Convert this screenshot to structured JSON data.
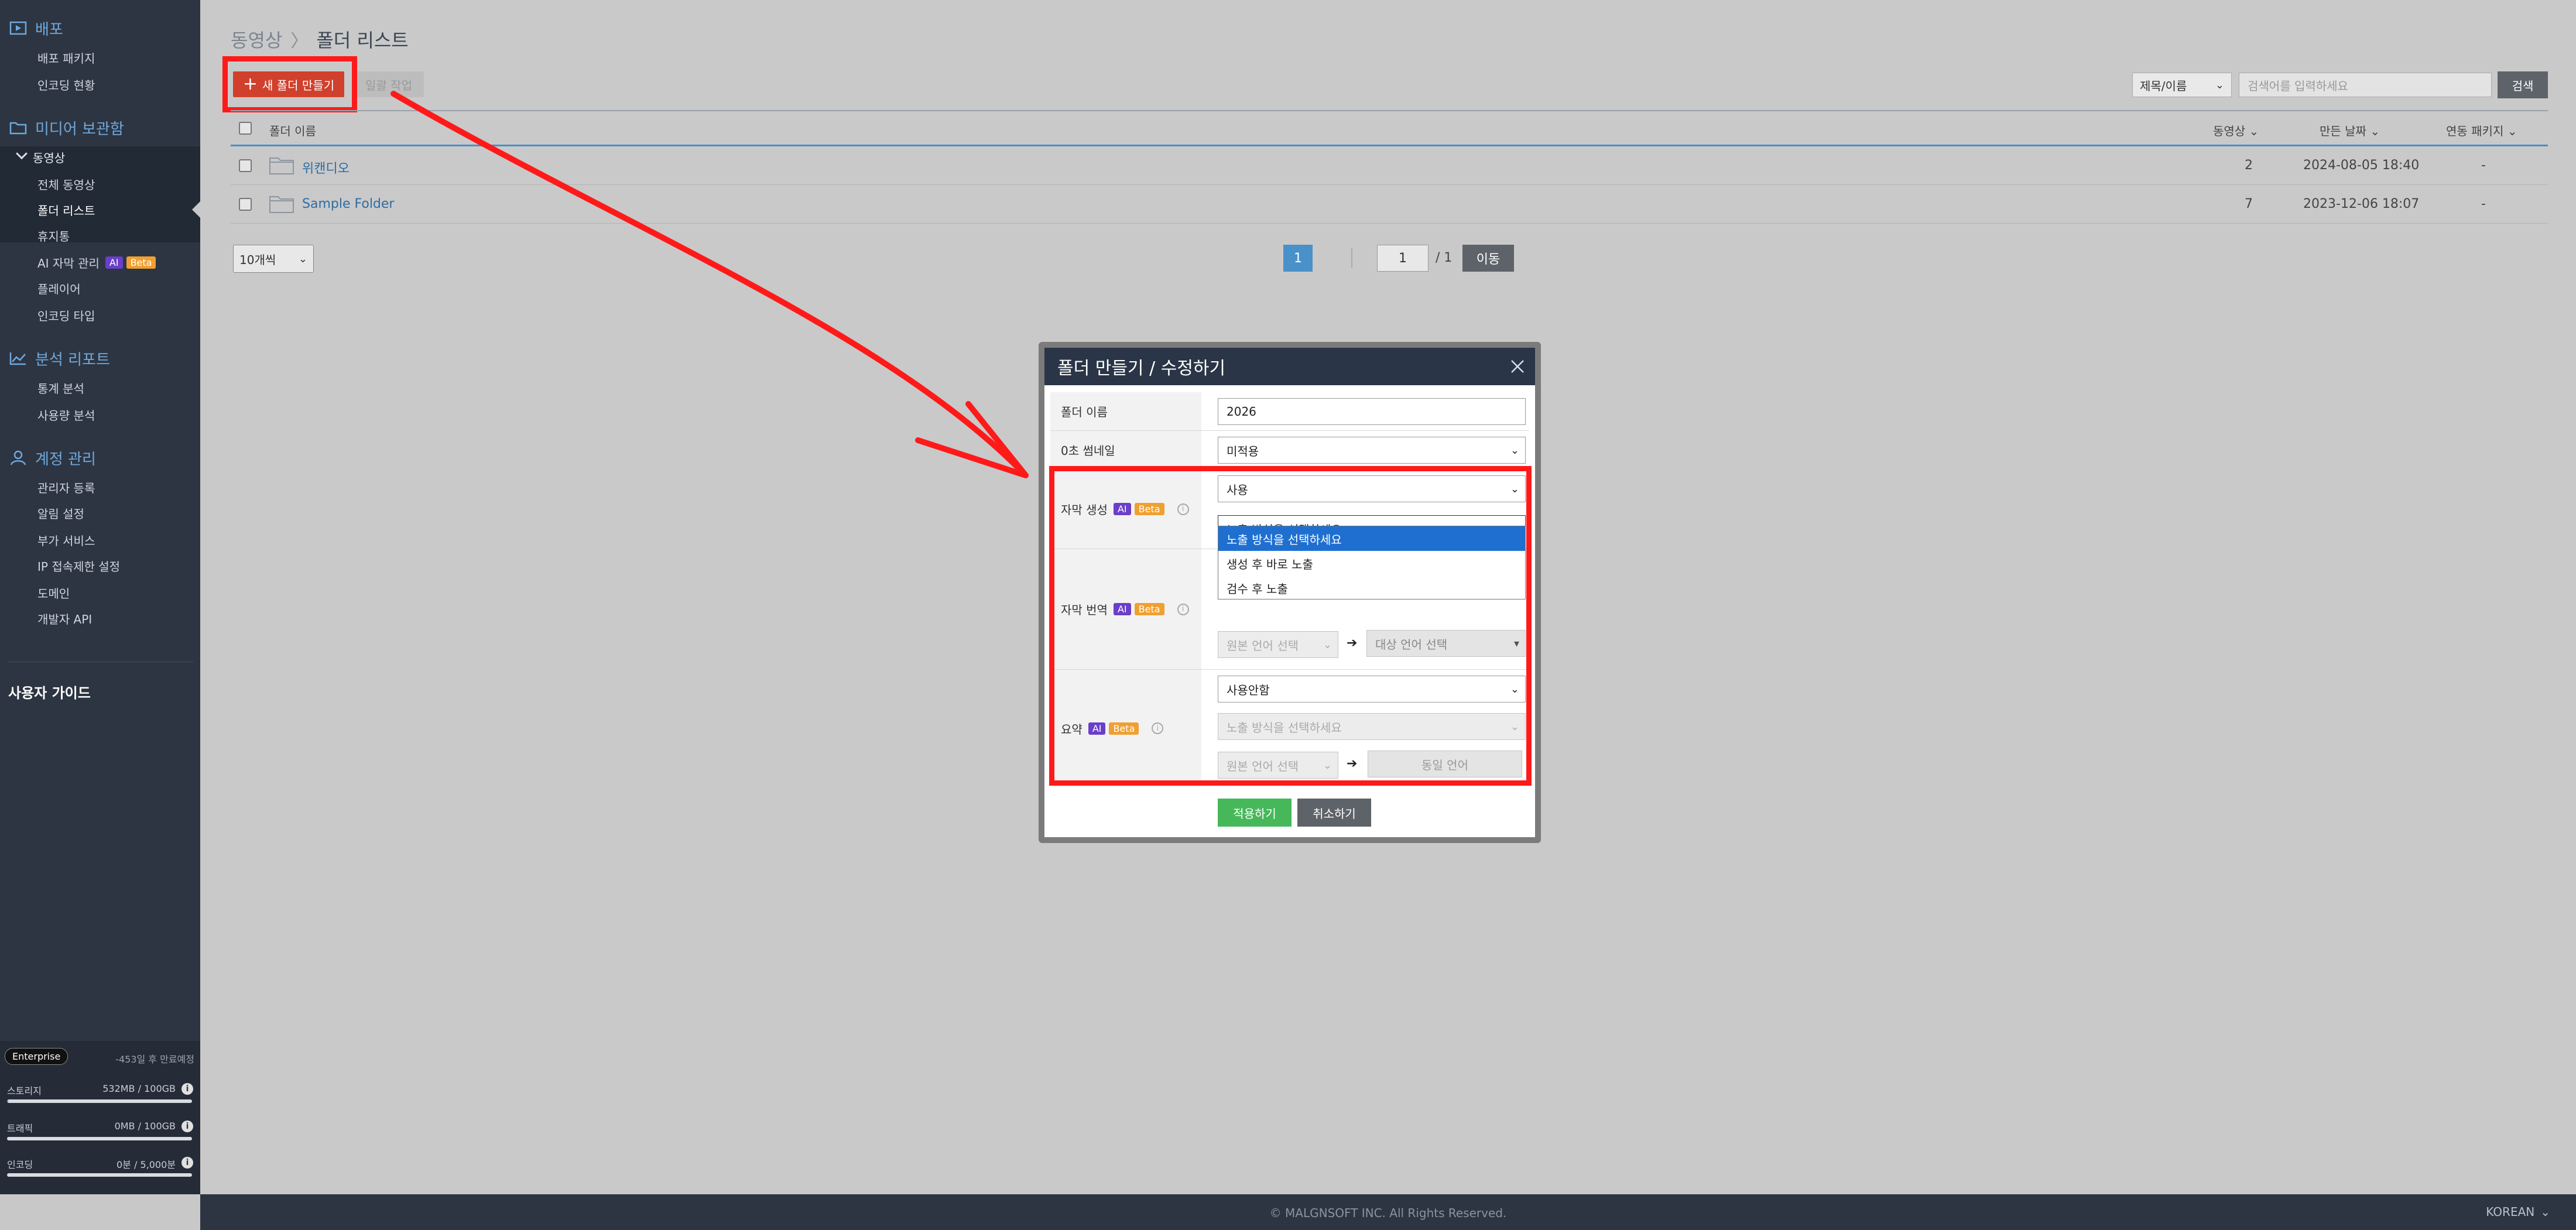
{
  "sidebar": {
    "sections": [
      {
        "title": "배포",
        "icon": "deploy-icon",
        "items": [
          "배포 패키지",
          "인코딩 현황"
        ]
      },
      {
        "title": "미디어 보관함",
        "icon": "folder-icon",
        "group": "동영상",
        "group_items": [
          "전체 동영상",
          "폴더 리스트",
          "휴지통"
        ],
        "items": [
          "AI 자막 관리",
          "플레이어",
          "인코딩 타입"
        ]
      },
      {
        "title": "분석 리포트",
        "icon": "chart-icon",
        "items": [
          "통계 분석",
          "사용량 분석"
        ]
      },
      {
        "title": "계정 관리",
        "icon": "user-icon",
        "items": [
          "관리자 등록",
          "알림 설정",
          "부가 서비스",
          "IP 접속제한 설정",
          "도메인",
          "개발자 API"
        ]
      }
    ],
    "ai_badge": "AI",
    "beta_badge": "Beta",
    "guide": "사용자 가이드",
    "plan": {
      "name": "Enterprise",
      "expire": "-453일 후 만료예정",
      "usage": [
        {
          "label": "스토리지",
          "value": "532MB / 100GB",
          "fraction": 0.005
        },
        {
          "label": "트래픽",
          "value": "0MB / 100GB",
          "fraction": 0.0
        },
        {
          "label": "인코딩",
          "value": "0분 / 5,000분",
          "fraction": 0.0
        }
      ]
    }
  },
  "main": {
    "breadcrumb": {
      "parent": "동영상",
      "sep": "〉",
      "current": "폴더 리스트"
    },
    "toolbar": {
      "new_folder": "새 폴더 만들기",
      "batch": "일괄 작업"
    },
    "search": {
      "select_value": "제목/이름",
      "placeholder": "검색어를 입력하세요",
      "button": "검색"
    },
    "table": {
      "headers": {
        "name": "폴더 이름",
        "videos": "동영상",
        "created": "만든 날짜",
        "linked": "연동 패키지"
      },
      "rows": [
        {
          "name": "위캔디오",
          "videos": "2",
          "created": "2024-08-05 18:40",
          "linked": "-"
        },
        {
          "name": "Sample Folder",
          "videos": "7",
          "created": "2023-12-06 18:07",
          "linked": "-"
        }
      ]
    },
    "pagination": {
      "per_page": "10개씩",
      "current": "1",
      "input": "1",
      "total": "/ 1",
      "go": "이동"
    }
  },
  "modal": {
    "title": "폴더 만들기 / 수정하기",
    "fields": {
      "folder_name_label": "폴더 이름",
      "folder_name_value": "2026",
      "thumbnail_label": "0초 썸네일",
      "thumbnail_value": "미적용",
      "subtitle_gen_label": "자막 생성",
      "subtitle_gen_value": "사용",
      "exposure_value": "노출 방식을 선택하세요",
      "exposure_options": [
        "노출 방식을 선택하세요",
        "생성 후 바로 노출",
        "검수 후 노출"
      ],
      "translate_label": "자막 번역",
      "source_lang": "원본 언어 선택",
      "target_lang": "대상 언어 선택",
      "summary_label": "요약",
      "summary_value": "사용안함",
      "summary_exposure": "노출 방식을 선택하세요",
      "summary_source_lang": "원본 언어 선택",
      "summary_target_lang": "동일 언어"
    },
    "apply": "적용하기",
    "cancel": "취소하기"
  },
  "footer": {
    "copyright": "© MALGNSOFT INC. All Rights Reserved.",
    "language": "KOREAN"
  },
  "colors": {
    "accent_red": "#d0402c",
    "annotation_red": "#ff1a1a",
    "sidebar_bg": "#2d3542",
    "link_blue": "#2e6da4",
    "page_blue": "#4a90c9",
    "apply_green": "#47b85a"
  }
}
